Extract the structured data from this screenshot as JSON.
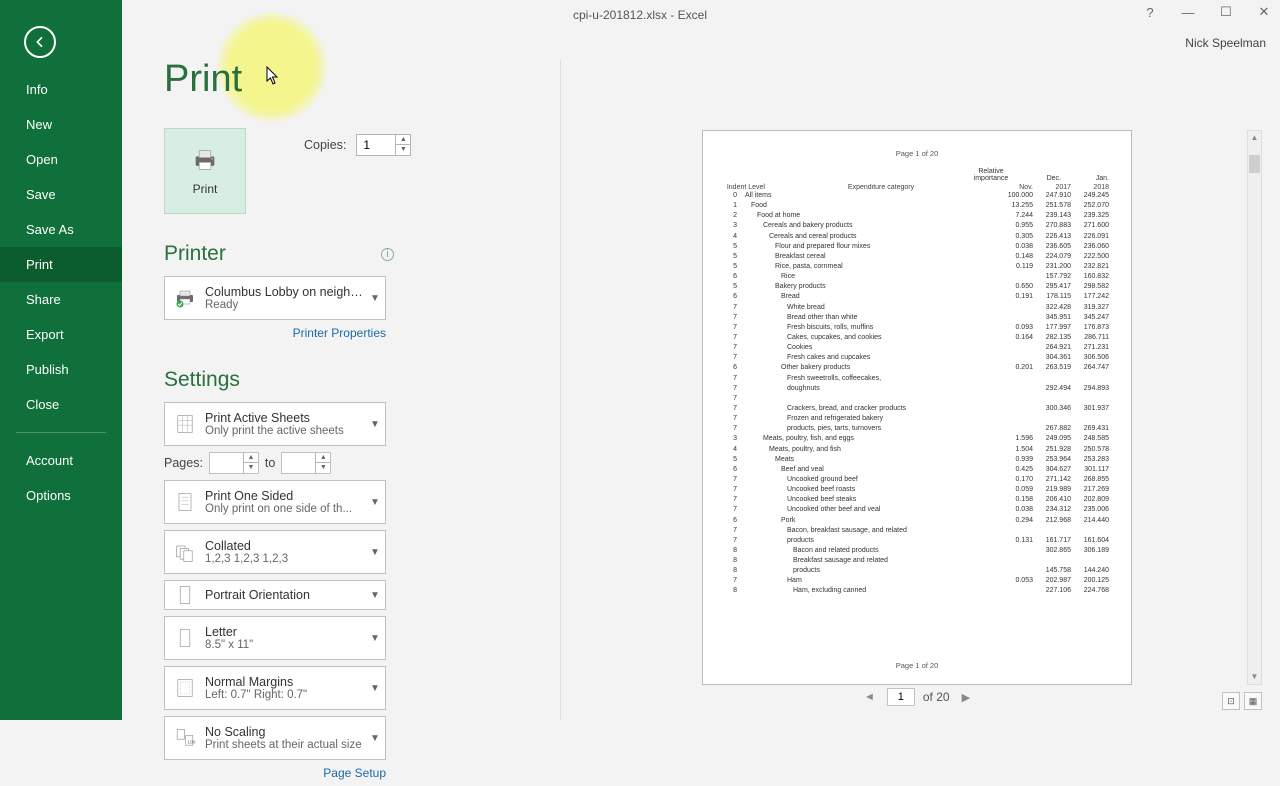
{
  "window": {
    "title": "cpi-u-201812.xlsx - Excel",
    "help_tip": "?",
    "user": "Nick Speelman"
  },
  "sidebar": {
    "items": [
      {
        "label": "Info"
      },
      {
        "label": "New"
      },
      {
        "label": "Open"
      },
      {
        "label": "Save"
      },
      {
        "label": "Save As"
      },
      {
        "label": "Print",
        "active": true
      },
      {
        "label": "Share"
      },
      {
        "label": "Export"
      },
      {
        "label": "Publish"
      },
      {
        "label": "Close"
      }
    ],
    "footer": [
      {
        "label": "Account"
      },
      {
        "label": "Options"
      }
    ]
  },
  "print": {
    "heading": "Print",
    "button_label": "Print",
    "copies_label": "Copies:",
    "copies_value": "1",
    "printer_heading": "Printer",
    "printer_name": "Columbus Lobby on neighb...",
    "printer_status": "Ready",
    "printer_properties": "Printer Properties",
    "settings_heading": "Settings",
    "what": {
      "line1": "Print Active Sheets",
      "line2": "Only print the active sheets"
    },
    "pages_label": "Pages:",
    "pages_to": "to",
    "sides": {
      "line1": "Print One Sided",
      "line2": "Only print on one side of th..."
    },
    "collate": {
      "line1": "Collated",
      "line2": "1,2,3    1,2,3    1,2,3"
    },
    "orient": {
      "line1": "Portrait Orientation"
    },
    "paper": {
      "line1": "Letter",
      "line2": "8.5\" x 11\""
    },
    "margins": {
      "line1": "Normal Margins",
      "line2": "Left:  0.7\"     Right:  0.7\""
    },
    "scaling": {
      "line1": "No Scaling",
      "line2": "Print sheets at their actual size"
    },
    "page_setup": "Page Setup"
  },
  "nav": {
    "current": "1",
    "total_label": "of 20"
  },
  "preview": {
    "page_label_top": "Page 1 of 20",
    "page_label_bottom": "Page 1 of 20",
    "col_indent": "Indent Level",
    "col_cat": "Expenditure category",
    "head_rel": "Relative",
    "head_imp": "importance",
    "head_nov": "Nov.",
    "head_dec": "Dec.",
    "head_2017": "2017",
    "head_jan": "Jan.",
    "head_2018": "2018",
    "rows": [
      {
        "lv": "0",
        "name": "All items",
        "v1": "100.000",
        "v2": "247.910",
        "v3": "249.245"
      },
      {
        "lv": "1",
        "name": "Food",
        "v1": "13.255",
        "v2": "251.578",
        "v3": "252.070"
      },
      {
        "lv": "2",
        "name": "Food at home",
        "v1": "7.244",
        "v2": "239.143",
        "v3": "239.325"
      },
      {
        "lv": "3",
        "name": "Cereals and bakery products",
        "v1": "0.955",
        "v2": "270.883",
        "v3": "271.600"
      },
      {
        "lv": "4",
        "name": "Cereals and cereal products",
        "v1": "0.305",
        "v2": "226.413",
        "v3": "226.091"
      },
      {
        "lv": "5",
        "name": "Flour and prepared flour mixes",
        "v1": "0.038",
        "v2": "236.605",
        "v3": "236.060"
      },
      {
        "lv": "5",
        "name": "Breakfast cereal",
        "v1": "0.148",
        "v2": "224.079",
        "v3": "222.500"
      },
      {
        "lv": "5",
        "name": "Rice, pasta, cornmeal",
        "v1": "0.119",
        "v2": "231.200",
        "v3": "232.821"
      },
      {
        "lv": "6",
        "name": "Rice",
        "v1": "",
        "v2": "157.792",
        "v3": "160.832"
      },
      {
        "lv": "5",
        "name": "Bakery products",
        "v1": "0.650",
        "v2": "295.417",
        "v3": "298.582"
      },
      {
        "lv": "6",
        "name": "Bread",
        "v1": "0.191",
        "v2": "178.115",
        "v3": "177.242"
      },
      {
        "lv": "7",
        "name": "White bread",
        "v1": "",
        "v2": "322.428",
        "v3": "319.327"
      },
      {
        "lv": "7",
        "name": "Bread other than white",
        "v1": "",
        "v2": "345.951",
        "v3": "345.247"
      },
      {
        "lv": "7",
        "name": "Fresh biscuits, rolls, muffins",
        "v1": "0.093",
        "v2": "177.997",
        "v3": "176.873"
      },
      {
        "lv": "7",
        "name": "Cakes, cupcakes, and cookies",
        "v1": "0.164",
        "v2": "282.135",
        "v3": "286.711"
      },
      {
        "lv": "7",
        "name": "Cookies",
        "v1": "",
        "v2": "264.921",
        "v3": "271.231"
      },
      {
        "lv": "7",
        "name": "Fresh cakes and cupcakes",
        "v1": "",
        "v2": "304.361",
        "v3": "306.506"
      },
      {
        "lv": "6",
        "name": "Other bakery products",
        "v1": "0.201",
        "v2": "263.519",
        "v3": "264.747"
      },
      {
        "lv": "7",
        "name": "Fresh sweetrolls, coffeecakes,",
        "v1": "",
        "v2": "",
        "v3": ""
      },
      {
        "lv": "7",
        "name": "doughnuts",
        "v1": "",
        "v2": "292.494",
        "v3": "294.893"
      },
      {
        "lv": "7",
        "name": "",
        "v1": "",
        "v2": "",
        "v3": ""
      },
      {
        "lv": "7",
        "name": "Crackers, bread, and cracker products",
        "v1": "",
        "v2": "300.346",
        "v3": "301.937"
      },
      {
        "lv": "7",
        "name": "Frozen and refrigerated bakery",
        "v1": "",
        "v2": "",
        "v3": ""
      },
      {
        "lv": "7",
        "name": "products, pies, tarts, turnovers",
        "v1": "",
        "v2": "267.882",
        "v3": "269.431"
      },
      {
        "lv": "3",
        "name": "Meats, poultry, fish, and eggs",
        "v1": "1.596",
        "v2": "249.095",
        "v3": "248.585"
      },
      {
        "lv": "4",
        "name": "Meats, poultry, and fish",
        "v1": "1.504",
        "v2": "251.928",
        "v3": "250.578"
      },
      {
        "lv": "5",
        "name": "Meats",
        "v1": "0.939",
        "v2": "253.964",
        "v3": "253.283"
      },
      {
        "lv": "6",
        "name": "Beef and veal",
        "v1": "0.425",
        "v2": "304.627",
        "v3": "301.117"
      },
      {
        "lv": "7",
        "name": "Uncooked ground beef",
        "v1": "0.170",
        "v2": "271.142",
        "v3": "268.855"
      },
      {
        "lv": "7",
        "name": "Uncooked beef roasts",
        "v1": "0.059",
        "v2": "219.989",
        "v3": "217.269"
      },
      {
        "lv": "7",
        "name": "Uncooked beef steaks",
        "v1": "0.158",
        "v2": "206.410",
        "v3": "202.809"
      },
      {
        "lv": "7",
        "name": "Uncooked other beef and veal",
        "v1": "0.038",
        "v2": "234.312",
        "v3": "235.006"
      },
      {
        "lv": "6",
        "name": "Pork",
        "v1": "0.294",
        "v2": "212.968",
        "v3": "214.440"
      },
      {
        "lv": "7",
        "name": "Bacon, breakfast sausage, and related",
        "v1": "",
        "v2": "",
        "v3": ""
      },
      {
        "lv": "7",
        "name": "products",
        "v1": "0.131",
        "v2": "161.717",
        "v3": "161.604"
      },
      {
        "lv": "8",
        "name": "Bacon and related products",
        "v1": "",
        "v2": "302.865",
        "v3": "306.189"
      },
      {
        "lv": "8",
        "name": "Breakfast sausage and related",
        "v1": "",
        "v2": "",
        "v3": ""
      },
      {
        "lv": "8",
        "name": "products",
        "v1": "",
        "v2": "145.758",
        "v3": "144.240"
      },
      {
        "lv": "7",
        "name": "Ham",
        "v1": "0.053",
        "v2": "202.987",
        "v3": "200.125"
      },
      {
        "lv": "8",
        "name": "Ham, excluding canned",
        "v1": "",
        "v2": "227.106",
        "v3": "224.768"
      }
    ]
  }
}
